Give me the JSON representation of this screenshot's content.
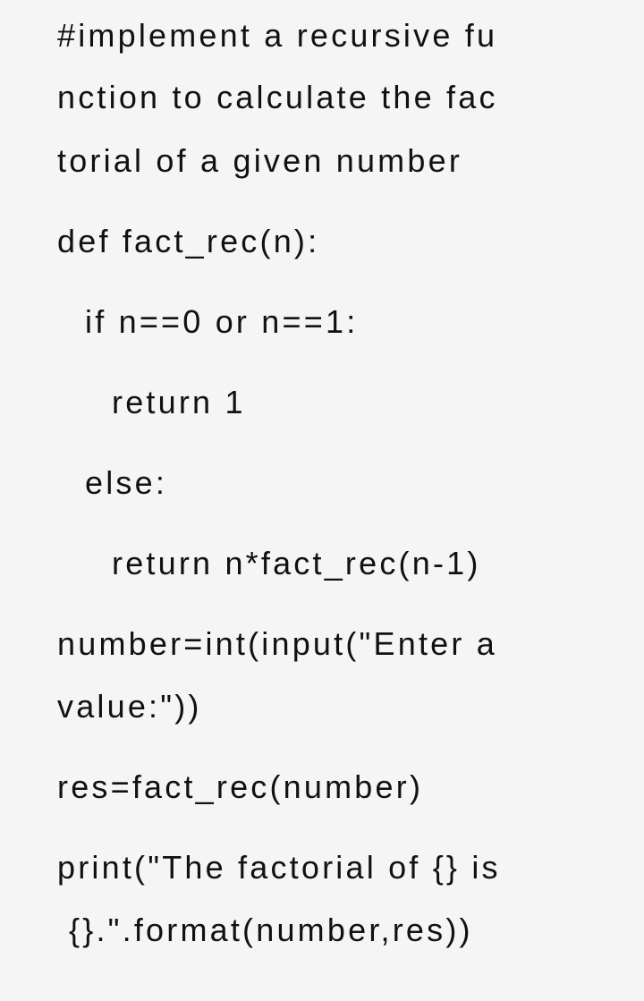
{
  "document": {
    "lines": [
      "#implement a recursive fu",
      "nction to calculate the fac",
      "torial of a given number",
      "def fact_rec(n):",
      "if n==0 or n==1:",
      "return 1",
      "else:",
      "return n*fact_rec(n-1)",
      "number=int(input(\"Enter a",
      "value:\"))",
      "res=fact_rec(number)",
      "print(\"The factorial of {} is",
      "{}.\".format(number,res))"
    ]
  }
}
